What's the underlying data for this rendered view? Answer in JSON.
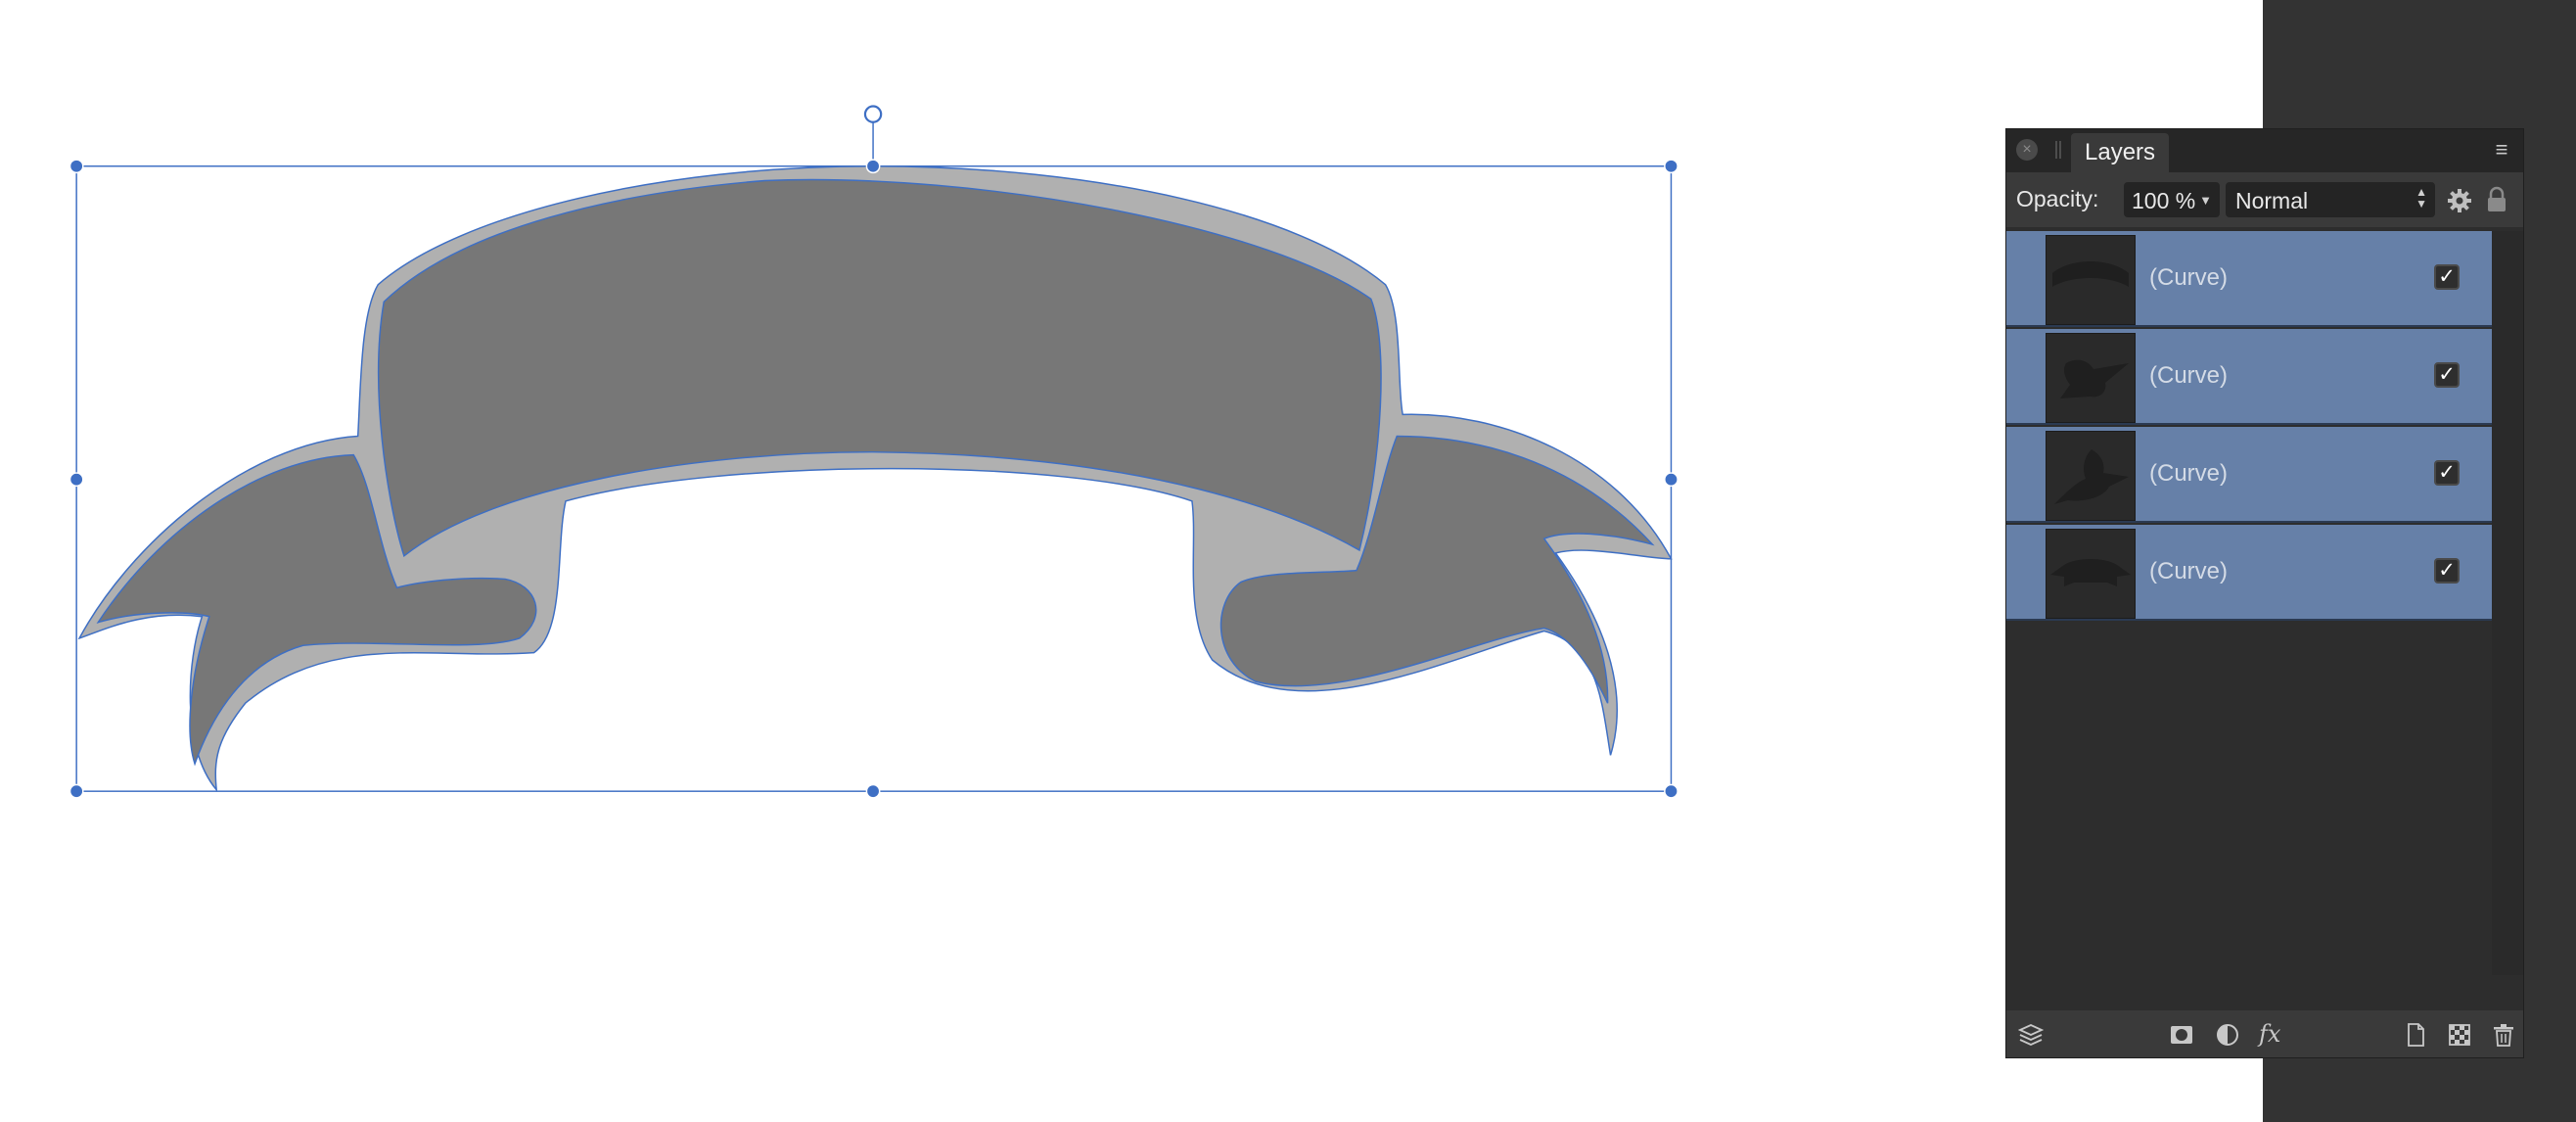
{
  "canvas": {
    "shape": "ribbon-banner",
    "fill_dark": "#777777",
    "fill_light": "#b0b0b0",
    "selection_color": "#3e6fc4",
    "handle_color": "#3e6fc4"
  },
  "layers_panel": {
    "close_icon": "close-icon",
    "tab_label": "Layers",
    "menu_icon": "panel-menu-icon",
    "opacity_label": "Opacity:",
    "opacity_value": "100 %",
    "blend_mode": "Normal",
    "toolbar_icons": [
      "gear-icon",
      "lock-icon"
    ],
    "selected_row_color": "#6680a8",
    "layers": [
      {
        "label": "(Curve)",
        "visible": true,
        "thumb": "banner-top"
      },
      {
        "label": "(Curve)",
        "visible": true,
        "thumb": "banner-left-tail"
      },
      {
        "label": "(Curve)",
        "visible": true,
        "thumb": "banner-right-tail"
      },
      {
        "label": "(Curve)",
        "visible": true,
        "thumb": "banner-outline"
      }
    ],
    "footer_icons": [
      "layers-stack-icon",
      "mask-icon",
      "adjustment-icon",
      "fx-icon",
      "add-layer-icon",
      "pixel-layer-icon",
      "delete-icon"
    ],
    "fx_label": "fx"
  }
}
